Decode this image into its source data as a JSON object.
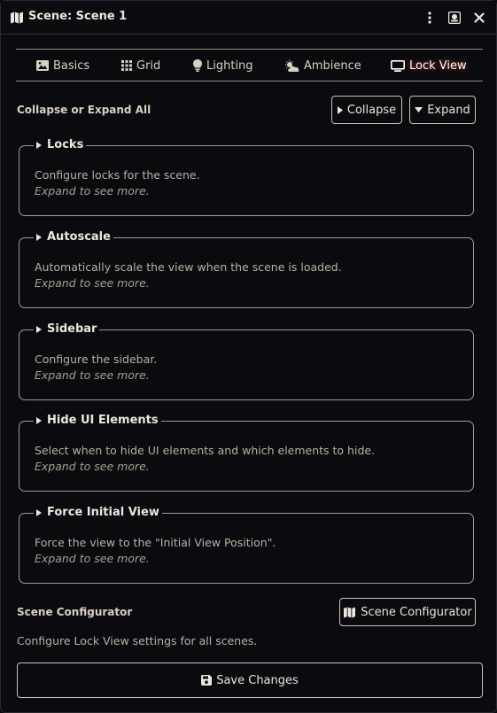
{
  "window": {
    "title": "Scene: Scene 1"
  },
  "tabs": [
    {
      "label": "Basics",
      "icon": "image-icon"
    },
    {
      "label": "Grid",
      "icon": "grid-icon"
    },
    {
      "label": "Lighting",
      "icon": "lightbulb-icon"
    },
    {
      "label": "Ambience",
      "icon": "cloud-sun-icon"
    },
    {
      "label": "Lock View",
      "icon": "tv-icon",
      "active": true
    }
  ],
  "collapse_expand": {
    "label": "Collapse or Expand All",
    "collapse_label": "Collapse",
    "expand_label": "Expand"
  },
  "sections": [
    {
      "title": "Locks",
      "description": "Configure locks for the scene.",
      "hint": "Expand to see more."
    },
    {
      "title": "Autoscale",
      "description": "Automatically scale the view when the scene is loaded.",
      "hint": "Expand to see more."
    },
    {
      "title": "Sidebar",
      "description": "Configure the sidebar.",
      "hint": "Expand to see more."
    },
    {
      "title": "Hide UI Elements",
      "description": "Select when to hide UI elements and which elements to hide.",
      "hint": "Expand to see more."
    },
    {
      "title": "Force Initial View",
      "description": "Force the view to the \"Initial View Position\".",
      "hint": "Expand to see more."
    }
  ],
  "scene_configurator": {
    "label": "Scene Configurator",
    "button_label": "Scene Configurator",
    "description": "Configure Lock View settings for all scenes."
  },
  "save": {
    "label": "Save Changes"
  },
  "colors": {
    "background": "#0b0a0f",
    "border": "#a39d92",
    "text": "#ece6dc",
    "muted_text": "#b9b1a4",
    "active_glow": "#ff5028"
  }
}
